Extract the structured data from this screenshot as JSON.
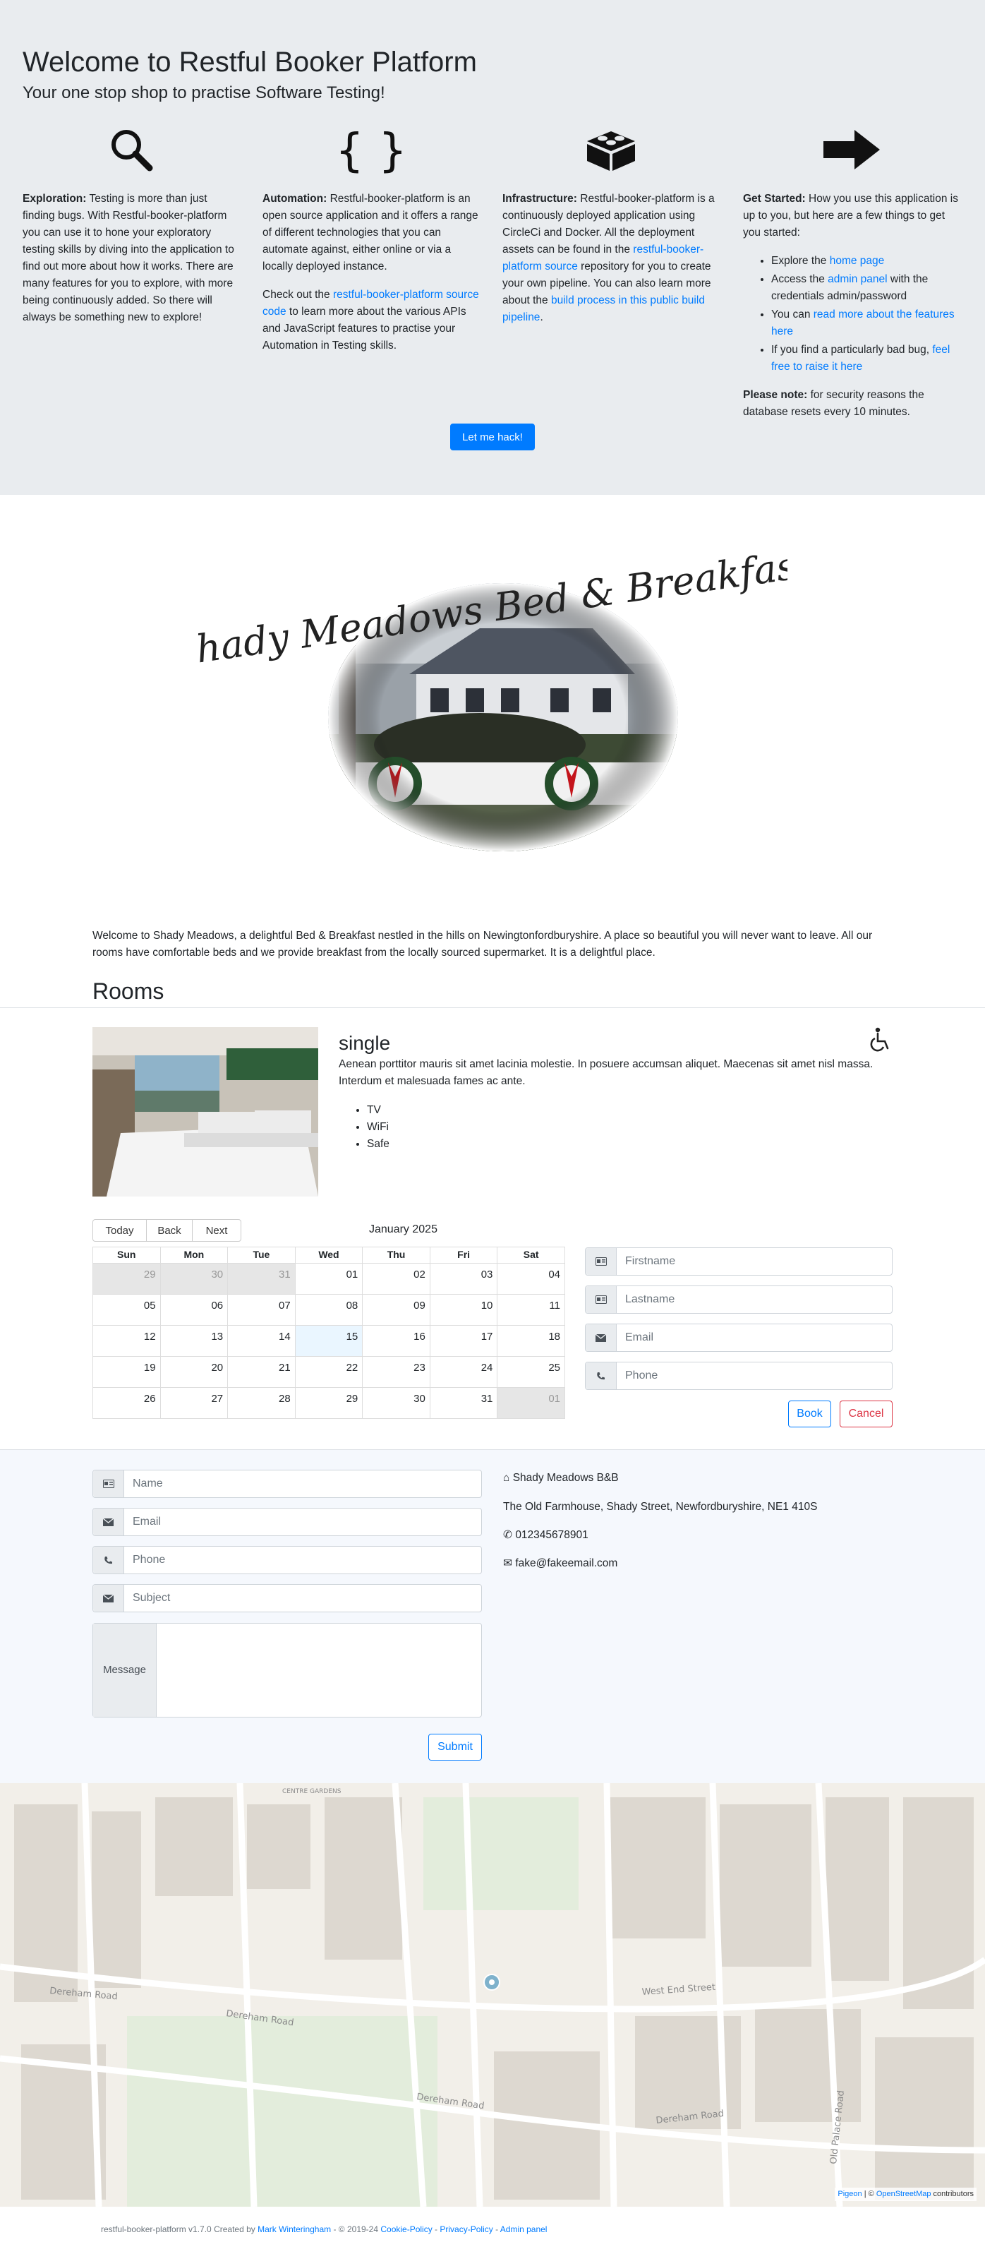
{
  "hero": {
    "title": "Welcome to Restful Booker Platform",
    "subtitle": "Your one stop shop to practise Software Testing!",
    "columns": [
      {
        "icon": "search-icon",
        "lead": "Exploration:",
        "text": " Testing is more than just finding bugs. With Restful-booker-platform you can use it to hone your exploratory testing skills by diving into the application to find out more about how it works. There are many features for you to explore, with more being continuously added. So there will always be something new to explore!"
      },
      {
        "icon": "code-braces-icon",
        "lead": "Automation:",
        "text": " Restful-booker-platform is an open source application and it offers a range of different technologies that you can automate against, either online or via a locally deployed instance.",
        "p2_before": "Check out the ",
        "p2_link": "restful-booker-platform source code",
        "p2_after": " to learn more about the various APIs and JavaScript features to practise your Automation in Testing skills."
      },
      {
        "icon": "cube-icon",
        "lead": "Infrastructure:",
        "text": " Restful-booker-platform is a continuously deployed application using CircleCi and Docker. All the deployment assets can be found in the ",
        "link1": "restful-booker-platform source",
        "mid": " repository for you to create your own pipeline. You can also learn more about the ",
        "link2": "build process in this public build pipeline",
        "end": "."
      },
      {
        "icon": "arrow-right-icon",
        "lead": "Get Started:",
        "text": " How you use this application is up to you, but here are a few things to get you started:",
        "li1_a": "Explore the ",
        "li1_link": "home page",
        "li2_a": "Access the ",
        "li2_link": "admin panel",
        "li2_b": " with the credentials admin/password",
        "li3_a": "You can ",
        "li3_link": "read more about the features here",
        "li4_a": "If you find a particularly bad bug, ",
        "li4_link": "feel free to raise it here",
        "note_lead": "Please note:",
        "note_text": " for security reasons the database resets every 10 minutes."
      }
    ],
    "button": "Let me hack!"
  },
  "logo": {
    "text": "Shady Meadows Bed & Breakfast"
  },
  "intro": "Welcome to Shady Meadows, a delightful Bed & Breakfast nestled in the hills on Newingtonfordburyshire. A place so beautiful you will never want to leave. All our rooms have comfortable beds and we provide breakfast from the locally sourced supermarket. It is a delightful place.",
  "rooms": {
    "heading": "Rooms",
    "room": {
      "name": "single",
      "description": "Aenean porttitor mauris sit amet lacinia molestie. In posuere accumsan aliquet. Maecenas sit amet nisl massa. Interdum et malesuada fames ac ante.",
      "amenities": [
        "TV",
        "WiFi",
        "Safe"
      ],
      "accessible_icon": "wheelchair-icon"
    }
  },
  "calendar": {
    "buttons": [
      "Today",
      "Back",
      "Next"
    ],
    "month": "January 2025",
    "days": [
      "Sun",
      "Mon",
      "Tue",
      "Wed",
      "Thu",
      "Fri",
      "Sat"
    ],
    "weeks": [
      [
        "29",
        "30",
        "31",
        "01",
        "02",
        "03",
        "04"
      ],
      [
        "05",
        "06",
        "07",
        "08",
        "09",
        "10",
        "11"
      ],
      [
        "12",
        "13",
        "14",
        "15",
        "16",
        "17",
        "18"
      ],
      [
        "19",
        "20",
        "21",
        "22",
        "23",
        "24",
        "25"
      ],
      [
        "26",
        "27",
        "28",
        "29",
        "30",
        "31",
        "01"
      ]
    ]
  },
  "booking": {
    "firstname": "Firstname",
    "lastname": "Lastname",
    "email": "Email",
    "phone": "Phone",
    "book": "Book",
    "cancel": "Cancel"
  },
  "contact": {
    "name": "Name",
    "email": "Email",
    "phone": "Phone",
    "subject": "Subject",
    "message": "Message",
    "submit": "Submit",
    "business": "Shady Meadows B&B",
    "address": "The Old Farmhouse, Shady Street, Newfordburyshire, NE1 410S",
    "tel": "012345678901",
    "mail": "fake@fakeemail.com"
  },
  "map": {
    "streets": [
      "Dereham Road",
      "Dereham Road",
      "Dereham Road",
      "Dereham Road",
      "West End Street",
      "Old Palace Road",
      "Pigeon",
      "OpenStreetMap"
    ],
    "attribution_pre": "© ",
    "attribution_post": " contributors",
    "area_label": "CENTRE GARDENS"
  },
  "footer": {
    "text": "restful-booker-platform v1.7.0 Created by ",
    "author": "Mark Winteringham",
    "years": " - © 2019-24 ",
    "cookie": "Cookie-Policy",
    "privacy": "Privacy-Policy",
    "admin": "Admin panel",
    "sep": " - "
  }
}
